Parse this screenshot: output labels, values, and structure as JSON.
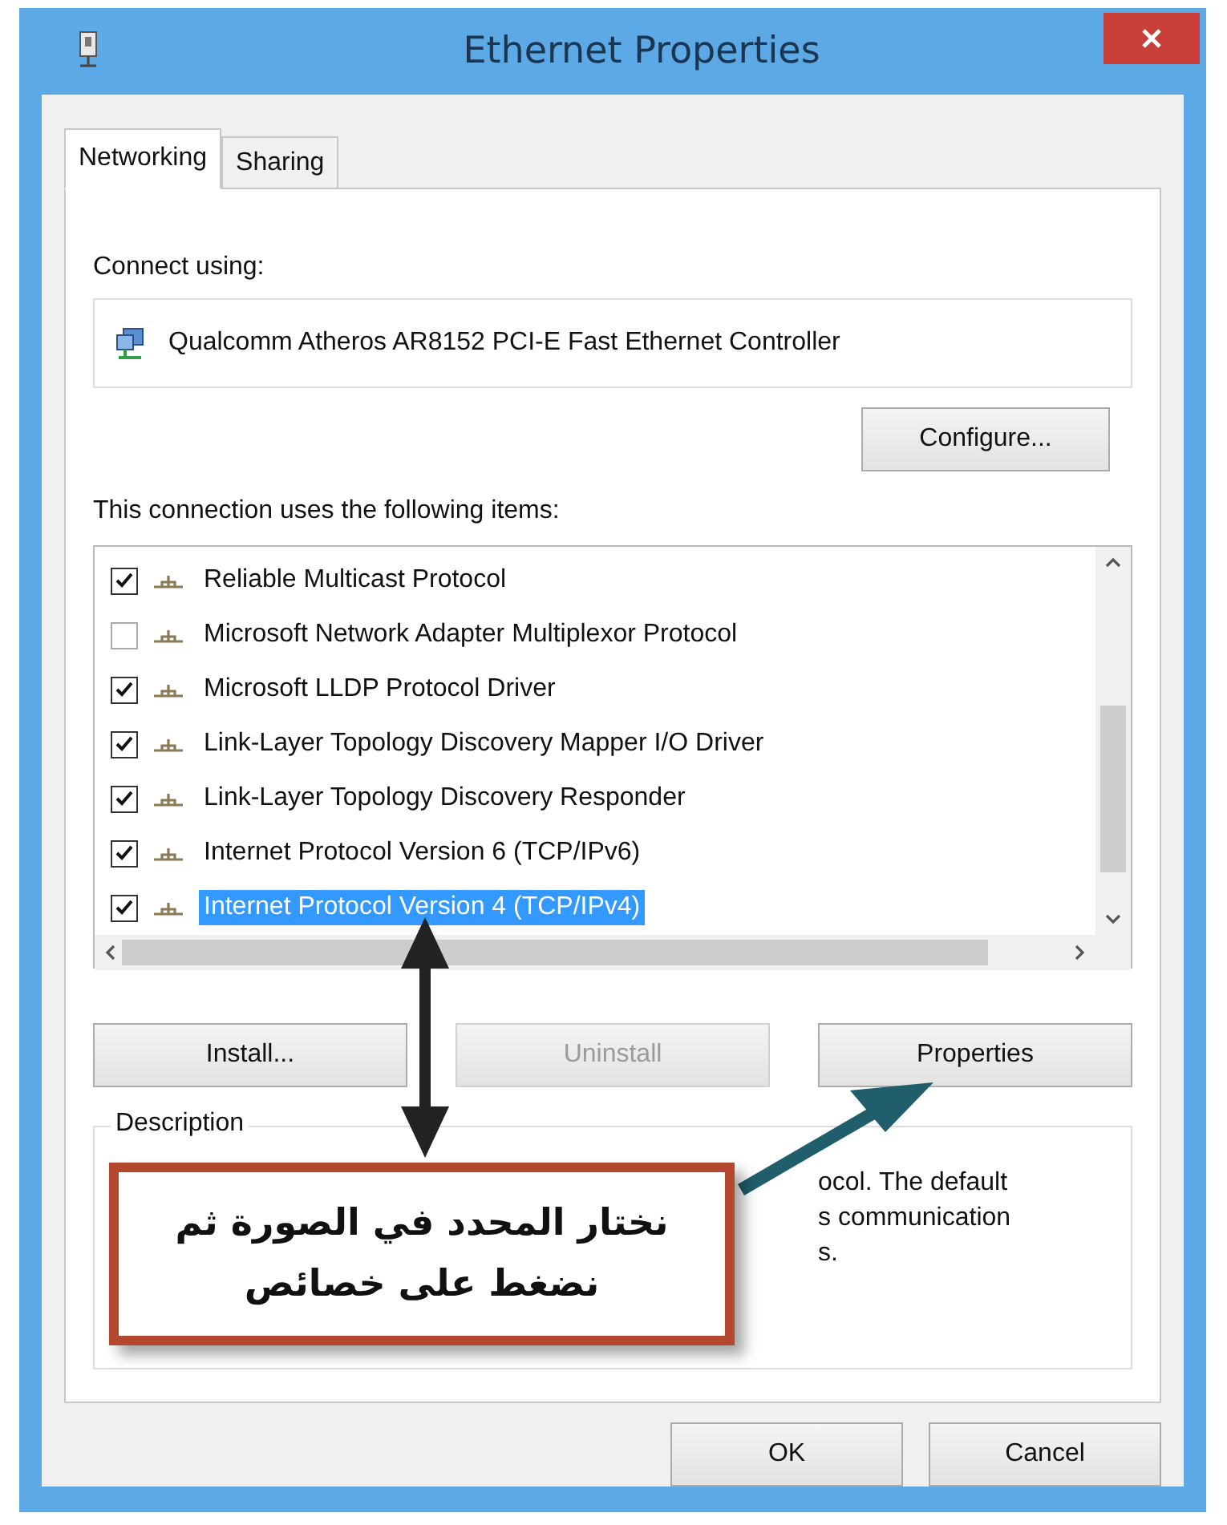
{
  "window": {
    "title": "Ethernet Properties"
  },
  "tabs": [
    {
      "label": "Networking",
      "selected": true
    },
    {
      "label": "Sharing",
      "selected": false
    }
  ],
  "connect_using": {
    "label": "Connect using:",
    "adapter": "Qualcomm Atheros AR8152 PCI-E Fast Ethernet Controller",
    "button": "Configure..."
  },
  "items_list": {
    "label": "This connection uses the following items:",
    "items": [
      {
        "name": "Reliable Multicast Protocol",
        "checked": true,
        "selected": false
      },
      {
        "name": "Microsoft Network Adapter Multiplexor Protocol",
        "checked": false,
        "selected": false
      },
      {
        "name": "Microsoft LLDP Protocol Driver",
        "checked": true,
        "selected": false
      },
      {
        "name": "Link-Layer Topology Discovery Mapper I/O Driver",
        "checked": true,
        "selected": false
      },
      {
        "name": "Link-Layer Topology Discovery Responder",
        "checked": true,
        "selected": false
      },
      {
        "name": "Internet Protocol Version 6 (TCP/IPv6)",
        "checked": true,
        "selected": false
      },
      {
        "name": "Internet Protocol Version 4 (TCP/IPv4)",
        "checked": true,
        "selected": true
      }
    ]
  },
  "item_buttons": [
    {
      "label": "Install...",
      "disabled": false
    },
    {
      "label": "Uninstall",
      "disabled": true
    },
    {
      "label": "Properties",
      "disabled": false
    }
  ],
  "description": {
    "label": "Description",
    "lines": [
      "ocol. The default",
      "s communication",
      "s."
    ]
  },
  "callout": {
    "lines": [
      "نختار المحدد في الصورة ثم",
      "نضغط على خصائص"
    ]
  },
  "footer_buttons": [
    "OK",
    "Cancel"
  ]
}
